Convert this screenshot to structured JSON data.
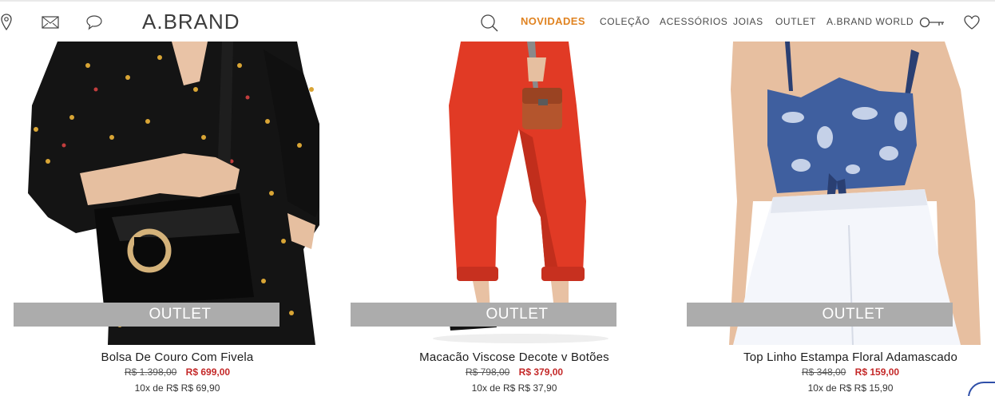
{
  "header": {
    "brand": "A.BRAND",
    "nav": [
      "NOVIDADES",
      "COLEÇÃO",
      "ACESSÓRIOS",
      "JOIAS",
      "OUTLET",
      "A.BRAND WORLD"
    ]
  },
  "colors": {
    "accent": "#e08321",
    "sale": "#c42828",
    "outlet_band": "#acacac"
  },
  "icons": [
    "location-pin-icon",
    "mail-icon",
    "chat-icon",
    "search-icon",
    "key-icon",
    "heart-icon"
  ],
  "products": [
    {
      "badge": "OUTLET",
      "name": "Bolsa De Couro Com Fivela",
      "old_price": "R$ 1.398,00",
      "price": "R$ 699,00",
      "installments": "10x de R$ R$ 69,90"
    },
    {
      "badge": "OUTLET",
      "name": "Macacão Viscose Decote v Botões",
      "old_price": "R$ 798,00",
      "price": "R$ 379,00",
      "installments": "10x de R$ R$ 37,90"
    },
    {
      "badge": "OUTLET",
      "name": "Top Linho Estampa Floral Adamascado",
      "old_price": "R$ 348,00",
      "price": "R$ 159,00",
      "installments": "10x de R$ R$ 15,90"
    }
  ]
}
